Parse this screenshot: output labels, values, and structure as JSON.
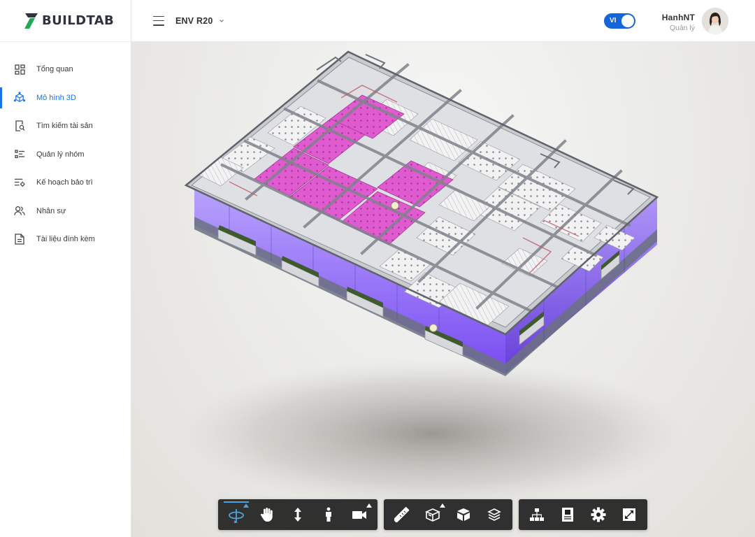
{
  "brand": {
    "name": "BUILDTAB",
    "logo_icon": "buildtab-logo-icon",
    "accent": "#1a73e8",
    "logo_color": "#21a956"
  },
  "sidebar": {
    "items": [
      {
        "label": "Tổng quan",
        "icon": "dashboard-icon",
        "active": false
      },
      {
        "label": "Mô hình 3D",
        "icon": "cube-3d-icon",
        "active": true
      },
      {
        "label": "Tìm kiếm tài sản",
        "icon": "search-document-icon",
        "active": false
      },
      {
        "label": "Quản lý nhóm",
        "icon": "list-icon",
        "active": false
      },
      {
        "label": "Kế hoạch bảo trì",
        "icon": "maintenance-plan-icon",
        "active": false
      },
      {
        "label": "Nhân sự",
        "icon": "people-icon",
        "active": false
      },
      {
        "label": "Tài liệu đính kèm",
        "icon": "document-icon",
        "active": false
      }
    ]
  },
  "header": {
    "project": "ENV R20",
    "language": "VI",
    "user": {
      "name": "HanhNT",
      "role": "Quản lý"
    }
  },
  "toolbar": {
    "groups": [
      [
        {
          "icon": "orbit-icon",
          "active": true,
          "has_submenu": true
        },
        {
          "icon": "pan-hand-icon",
          "active": false,
          "has_submenu": false
        },
        {
          "icon": "zoom-vertical-icon",
          "active": false,
          "has_submenu": false
        },
        {
          "icon": "first-person-icon",
          "active": false,
          "has_submenu": false
        },
        {
          "icon": "camera-icon",
          "active": false,
          "has_submenu": true
        }
      ],
      [
        {
          "icon": "measure-ruler-icon",
          "active": false,
          "has_submenu": false
        },
        {
          "icon": "section-box-icon",
          "active": false,
          "has_submenu": true
        },
        {
          "icon": "explode-model-icon",
          "active": false,
          "has_submenu": false
        },
        {
          "icon": "layers-icon",
          "active": false,
          "has_submenu": false
        }
      ],
      [
        {
          "icon": "model-browser-icon",
          "active": false,
          "has_submenu": false
        },
        {
          "icon": "properties-icon",
          "active": false,
          "has_submenu": false
        },
        {
          "icon": "settings-gear-icon",
          "active": false,
          "has_submenu": false
        },
        {
          "icon": "fullscreen-icon",
          "active": false,
          "has_submenu": false
        }
      ]
    ]
  }
}
